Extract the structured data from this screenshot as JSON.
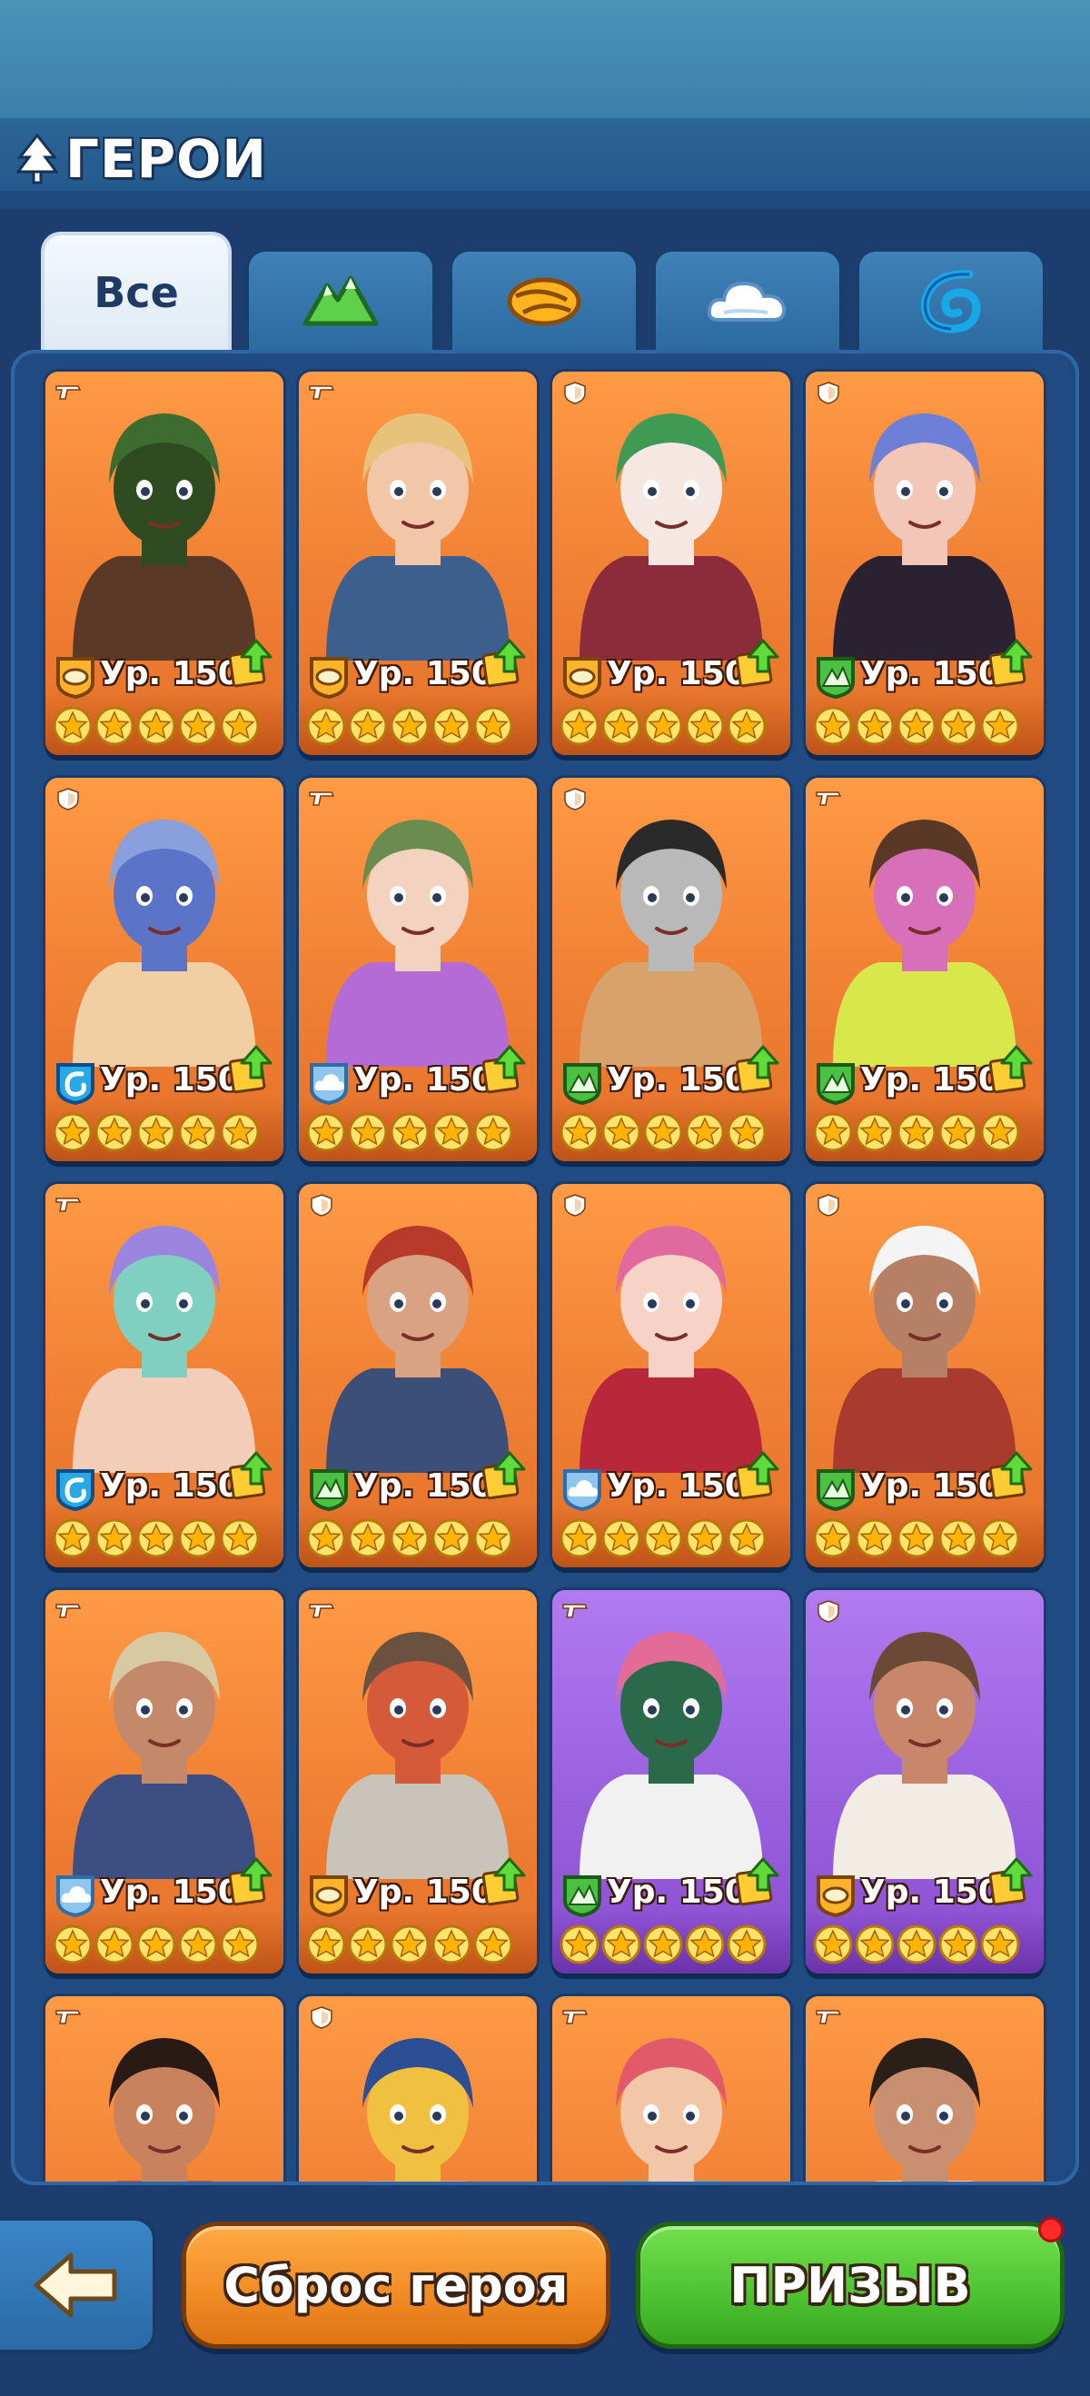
{
  "header": {
    "title": "ГЕРОИ"
  },
  "tabs": [
    {
      "label": "Все",
      "icon": "all-tab",
      "active": true
    },
    {
      "label": "",
      "icon": "nature-faction-icon",
      "active": false
    },
    {
      "label": "",
      "icon": "desert-faction-icon",
      "active": false
    },
    {
      "label": "",
      "icon": "cloud-faction-icon",
      "active": false
    },
    {
      "label": "",
      "icon": "water-faction-icon",
      "active": false
    }
  ],
  "heroes": [
    {
      "level": "Ур. 150",
      "faction": "desert",
      "type": "gun",
      "stars": 5,
      "rarity": "orange",
      "palette": [
        "#3e6b2f",
        "#5a3a26",
        "#2f4b22"
      ]
    },
    {
      "level": "Ур. 150",
      "faction": "desert",
      "type": "gun",
      "stars": 5,
      "rarity": "orange",
      "palette": [
        "#e8c27a",
        "#3d5f8e",
        "#f2c7a8"
      ]
    },
    {
      "level": "Ур. 150",
      "faction": "desert",
      "type": "shield",
      "stars": 5,
      "rarity": "orange",
      "palette": [
        "#3f9b54",
        "#8c2b3a",
        "#f5e8e2"
      ]
    },
    {
      "level": "Ур. 150",
      "faction": "nature",
      "type": "shield",
      "stars": 5,
      "rarity": "orange",
      "palette": [
        "#6d7fd6",
        "#2a2230",
        "#f2c7b8"
      ]
    },
    {
      "level": "Ур. 150",
      "faction": "water",
      "type": "shield",
      "stars": 5,
      "rarity": "orange",
      "palette": [
        "#8aa0dc",
        "#f2cfa2",
        "#5b74c8"
      ]
    },
    {
      "level": "Ур. 150",
      "faction": "cloud",
      "type": "gun",
      "stars": 5,
      "rarity": "orange",
      "palette": [
        "#6a8c4e",
        "#b56bd6",
        "#f3d2c0"
      ]
    },
    {
      "level": "Ур. 150",
      "faction": "nature",
      "type": "shield",
      "stars": 5,
      "rarity": "orange",
      "palette": [
        "#2a2a2a",
        "#d8a36a",
        "#b9b9b9"
      ]
    },
    {
      "level": "Ур. 150",
      "faction": "nature",
      "type": "gun",
      "stars": 5,
      "rarity": "orange",
      "palette": [
        "#5a3826",
        "#d8e84a",
        "#d86fb9"
      ]
    },
    {
      "level": "Ур. 150",
      "faction": "water",
      "type": "gun",
      "stars": 5,
      "rarity": "orange",
      "palette": [
        "#9b84e0",
        "#f2cdb8",
        "#7fd0c0"
      ]
    },
    {
      "level": "Ур. 150",
      "faction": "nature",
      "type": "shield",
      "stars": 5,
      "rarity": "orange",
      "palette": [
        "#b83a2a",
        "#3c4f78",
        "#d9a283"
      ]
    },
    {
      "level": "Ур. 150",
      "faction": "cloud",
      "type": "shield",
      "stars": 5,
      "rarity": "orange",
      "palette": [
        "#e06a9e",
        "#b8283a",
        "#f6d3c6"
      ]
    },
    {
      "level": "Ур. 150",
      "faction": "nature",
      "type": "shield",
      "stars": 5,
      "rarity": "orange",
      "palette": [
        "#f4f4f4",
        "#a83a2e",
        "#b58066"
      ]
    },
    {
      "level": "Ур. 150",
      "faction": "cloud",
      "type": "gun",
      "stars": 5,
      "rarity": "orange",
      "palette": [
        "#d7c9a2",
        "#3c4e82",
        "#c4896a"
      ]
    },
    {
      "level": "Ур. 150",
      "faction": "desert",
      "type": "gun",
      "stars": 5,
      "rarity": "orange",
      "palette": [
        "#6b5140",
        "#c9c3b9",
        "#d45a3a"
      ]
    },
    {
      "level": "Ур. 150",
      "faction": "nature",
      "type": "gun",
      "stars": 5,
      "rarity": "purple",
      "palette": [
        "#e36b98",
        "#f1f1f1",
        "#2a6a4a"
      ]
    },
    {
      "level": "Ур. 150",
      "faction": "desert",
      "type": "shield",
      "stars": 5,
      "rarity": "purple",
      "palette": [
        "#6a4a36",
        "#f1ece4",
        "#c8876a"
      ]
    },
    {
      "level": "",
      "faction": "",
      "type": "gun",
      "stars": 0,
      "rarity": "orange",
      "palette": [
        "#2a1a16",
        "#d0493c",
        "#c8835e"
      ]
    },
    {
      "level": "",
      "faction": "",
      "type": "shield",
      "stars": 0,
      "rarity": "orange",
      "palette": [
        "#2b4e94",
        "#d9a27a",
        "#f0c040"
      ]
    },
    {
      "level": "",
      "faction": "",
      "type": "gun",
      "stars": 0,
      "rarity": "orange",
      "palette": [
        "#e05a6a",
        "#6ab4c8",
        "#f2c7a8"
      ]
    },
    {
      "level": "",
      "faction": "",
      "type": "gun",
      "stars": 0,
      "rarity": "orange",
      "palette": [
        "#2b1f1a",
        "#f2c7a8",
        "#c89070"
      ]
    }
  ],
  "buttons": {
    "reset": "Сброс героя",
    "summon": "ПРИЗЫВ"
  }
}
